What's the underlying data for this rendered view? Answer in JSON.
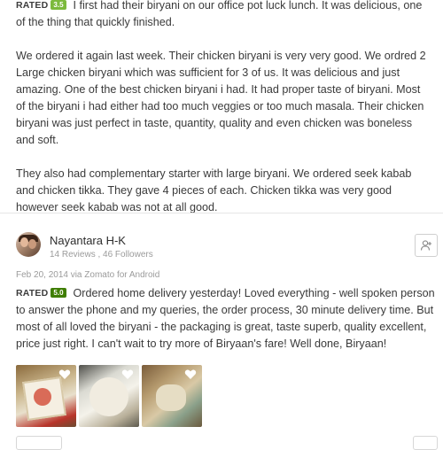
{
  "review1": {
    "rated_label": "RATED",
    "rating": "3.5",
    "rating_color": "#7cba3c",
    "paragraph1": "I first had their biryani on our office pot luck lunch. It was delicious, one of the thing that quickly finished.",
    "paragraph2": "We ordered it again last week. Their chicken biryani is very very good. We ordred 2 Large chicken biryani which was sufficient for 3 of us. It was delicious and just amazing. One of the best chicken biryani i had. It had proper taste of biryani. Most of the biryani i had either had too much veggies or too much masala. Their chicken biryani was just perfect in taste, quantity, quality and even chicken was boneless and soft.",
    "paragraph3": "They also had complementary starter with large biryani. We ordered seek kabab and chicken tikka. They gave 4 pieces of each. Chicken tikka was very good however seek kabab was not at all good."
  },
  "review2": {
    "user_name": "Nayantara H-K",
    "user_stats": "14 Reviews , 46 Followers",
    "date": "Feb 20, 2014 via Zomato for Android",
    "rated_label": "RATED",
    "rating": "5.0",
    "rating_color": "#3f7e00",
    "text": "Ordered home delivery yesterday! Loved everything - well spoken person to answer the phone and my queries, the order process, 30 minute delivery time. But most of all loved the biryani - the packaging is great, taste superb, quality excellent, price just right. I can't wait to try more of Biryaan's fare! Well done, Biryaan!",
    "follow_icon": "add-user-icon",
    "photos": [
      {
        "icon": "heart-icon"
      },
      {
        "icon": "heart-icon"
      },
      {
        "icon": "heart-icon"
      }
    ]
  }
}
